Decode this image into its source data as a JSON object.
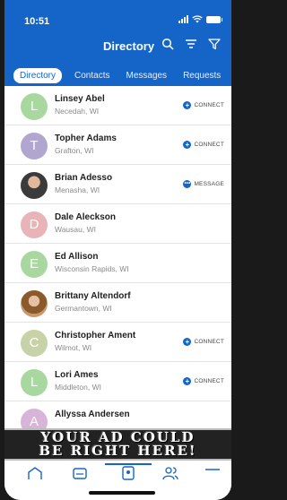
{
  "status": {
    "time": "10:51"
  },
  "header": {
    "title": "Directory"
  },
  "tabs": [
    "Directory",
    "Contacts",
    "Messages",
    "Requests"
  ],
  "contacts": [
    {
      "initial": "L",
      "name": "Linsey Abel",
      "location": "Necedah, WI",
      "avatar_color": "#a8d8a0",
      "action": "CONNECT"
    },
    {
      "initial": "T",
      "name": "Topher Adams",
      "location": "Grafton, WI",
      "avatar_color": "#b0a6cf",
      "action": "CONNECT"
    },
    {
      "initial": "",
      "name": "Brian Adesso",
      "location": "Menasha, WI",
      "avatar_color": "",
      "action": "MESSAGE"
    },
    {
      "initial": "D",
      "name": "Dale Aleckson",
      "location": "Wausau, WI",
      "avatar_color": "#e8b4b8",
      "action": ""
    },
    {
      "initial": "E",
      "name": "Ed Allison",
      "location": "Wisconsin Rapids, WI",
      "avatar_color": "#a8d8a0",
      "action": ""
    },
    {
      "initial": "",
      "name": "Brittany Altendorf",
      "location": "Germantown, WI",
      "avatar_color": "",
      "action": ""
    },
    {
      "initial": "C",
      "name": "Christopher Ament",
      "location": "Wilmot, WI",
      "avatar_color": "#c8d2a8",
      "action": "CONNECT"
    },
    {
      "initial": "L",
      "name": "Lori Ames",
      "location": "Middleton, WI",
      "avatar_color": "#a8d8a0",
      "action": "CONNECT"
    },
    {
      "initial": "A",
      "name": "Allyssa Andersen",
      "location": "",
      "avatar_color": "#d8b4d8",
      "action": ""
    }
  ],
  "ad": {
    "line1": "YOUR AD COULD",
    "line2": "BE RIGHT HERE!"
  },
  "colors": {
    "brand": "#1565c9"
  }
}
